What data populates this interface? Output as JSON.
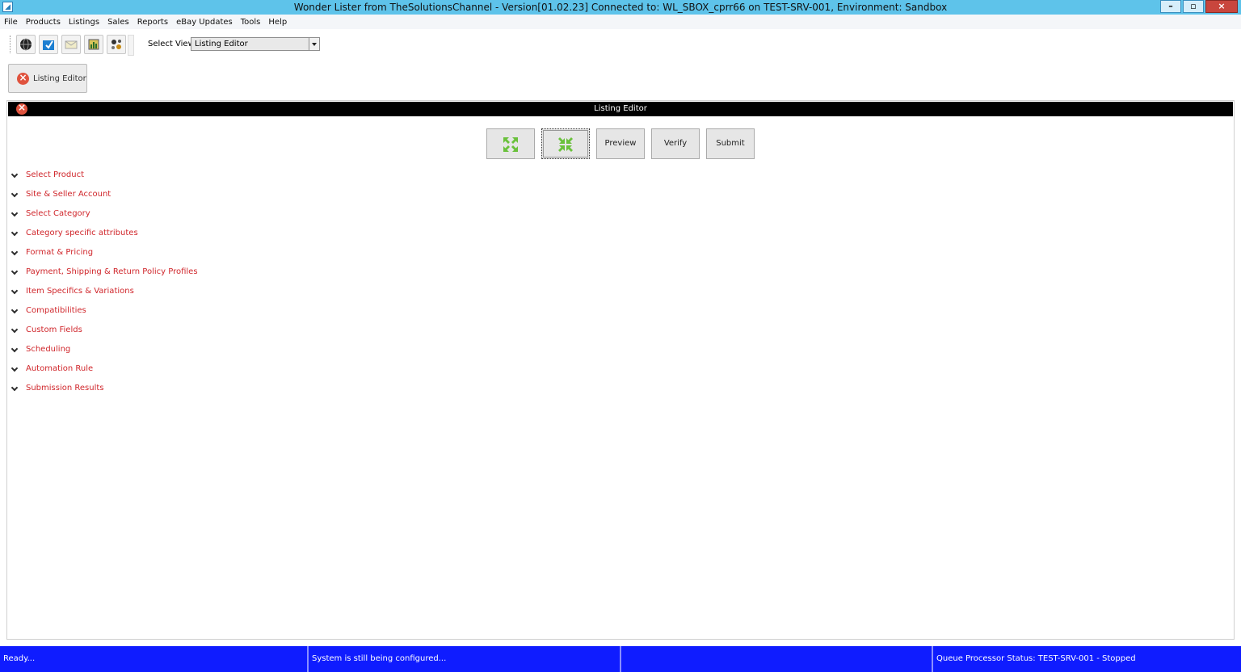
{
  "window": {
    "title": "Wonder Lister from TheSolutionsChannel - Version[01.02.23] Connected to: WL_SBOX_cprr66 on TEST-SRV-001, Environment: Sandbox",
    "buttons": {
      "minimize": "–",
      "restore": "▫",
      "close": "×"
    }
  },
  "menu": [
    "File",
    "Products",
    "Listings",
    "Sales",
    "Reports",
    "eBay Updates",
    "Tools",
    "Help"
  ],
  "toolbar": {
    "icons": [
      "globe-icon",
      "import-icon",
      "envelope-icon",
      "report-icon",
      "tools-icon"
    ],
    "select_view_label": "Select View:",
    "select_view_value": "Listing Editor"
  },
  "doc_tab": {
    "label": "Listing Editor"
  },
  "panel": {
    "title": "Listing Editor",
    "actions": {
      "expand_all": "expand-all-icon",
      "collapse_all": "collapse-all-icon",
      "preview": "Preview",
      "verify": "Verify",
      "submit": "Submit"
    },
    "sections": [
      "Select Product",
      "Site & Seller Account",
      "Select Category",
      "Category specific attributes",
      "Format & Pricing",
      "Payment, Shipping & Return Policy Profiles",
      "Item Specifics & Variations",
      "Compatibilities",
      "Custom Fields",
      "Scheduling",
      "Automation Rule",
      "Submission Results"
    ]
  },
  "status": {
    "ready": "Ready...",
    "config": "System is still being configured...",
    "middle": "",
    "queue": "Queue Processor Status: TEST-SRV-001 - Stopped"
  },
  "colors": {
    "titlebar": "#5ec3ea",
    "statusbar": "#0f1cff",
    "section_text": "#d0262b",
    "panel_header": "#000000",
    "accent_green": "#6ac13c"
  }
}
